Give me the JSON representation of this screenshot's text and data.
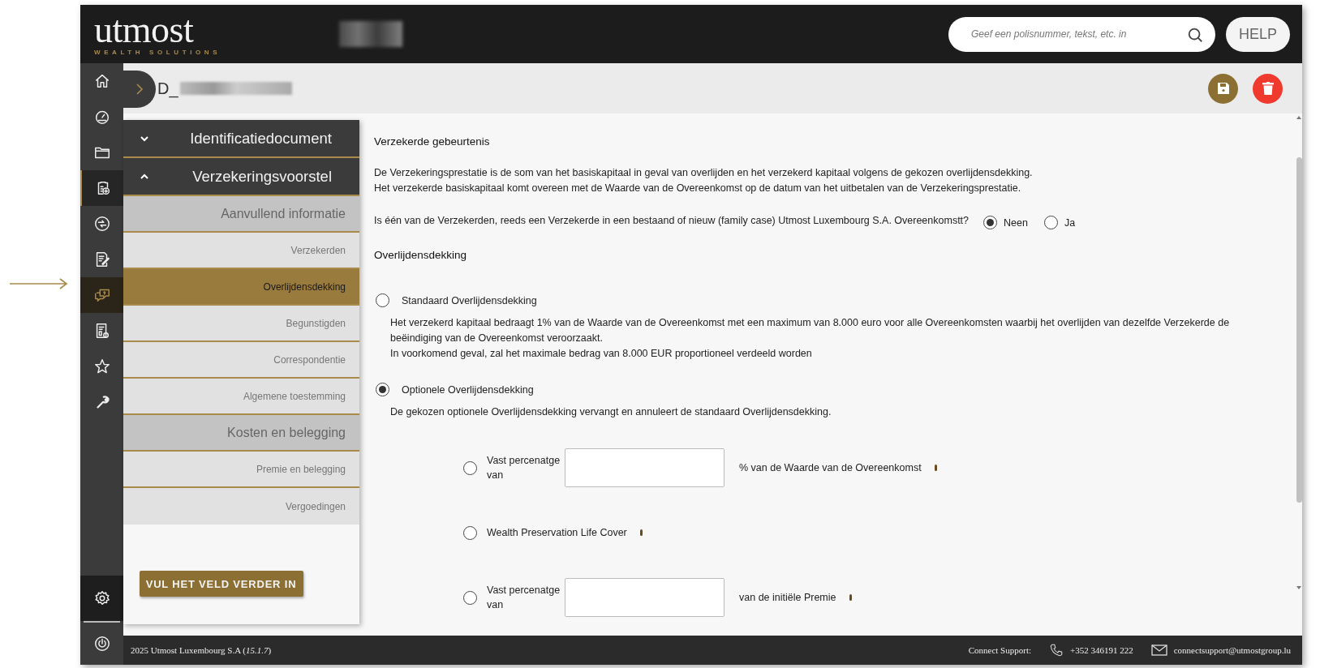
{
  "header": {
    "logo": "utmost",
    "logo_subtitle": "WEALTH SOLUTIONS",
    "search": {
      "placeholder": "Geef een polisnummer, tekst, etc. in"
    },
    "help": "HELP"
  },
  "rail": {
    "items": [
      {
        "kind": "home",
        "selected": false,
        "highlighted": false
      },
      {
        "kind": "gauge",
        "selected": false,
        "highlighted": false
      },
      {
        "kind": "folder",
        "selected": false,
        "highlighted": false
      },
      {
        "kind": "clipboard",
        "selected": false,
        "highlighted": true
      },
      {
        "kind": "globe",
        "selected": false,
        "highlighted": false
      },
      {
        "kind": "edit",
        "selected": false,
        "highlighted": false
      },
      {
        "kind": "chat",
        "selected": true,
        "highlighted": false
      },
      {
        "kind": "report",
        "selected": false,
        "highlighted": false
      },
      {
        "kind": "star",
        "selected": false,
        "highlighted": false
      },
      {
        "kind": "wrench",
        "selected": false,
        "highlighted": false
      }
    ],
    "bottom_items": [
      {
        "kind": "gear"
      },
      {
        "kind": "power"
      }
    ]
  },
  "record_title": "D_",
  "nav": {
    "sections": [
      {
        "label": "Identificatiedocument",
        "expanded": false
      },
      {
        "label": "Verzekeringsvoorstel",
        "expanded": true,
        "children": [
          {
            "kind": "group",
            "label": "Aanvullend informatie"
          },
          {
            "kind": "page",
            "label": "Verzekerden",
            "selected": false
          },
          {
            "kind": "page",
            "label": "Overlijdensdekking",
            "selected": true
          },
          {
            "kind": "page",
            "label": "Begunstigden",
            "selected": false
          },
          {
            "kind": "page",
            "label": "Correspondentie",
            "selected": false
          },
          {
            "kind": "page",
            "label": "Algemene toestemming",
            "selected": false
          },
          {
            "kind": "group",
            "label": "Kosten en belegging"
          },
          {
            "kind": "page",
            "label": "Premie en belegging",
            "selected": false
          },
          {
            "kind": "page",
            "label": "Vergoedingen",
            "selected": false
          }
        ]
      }
    ],
    "button": "VUL HET VELD VERDER IN"
  },
  "content": {
    "heading": "Verzekerde gebeurtenis",
    "paragraph": [
      "De Verzekeringsprestatie is de som van het basiskapitaal in geval van overlijden en het verzekerd kapitaal volgens de gekozen overlijdensdekking.",
      "Het verzekerde basiskapitaal komt overeen met de Waarde van de Overeenkomst op de datum van het uitbetalen van de Verzekeringsprestatie."
    ],
    "question": "Is één van de Verzekerden, reeds een Verzekerde in een bestaand of nieuw (family case) Utmost Luxembourg S.A. Overeenkomstt?",
    "answers": [
      {
        "label": "Neen",
        "selected": true
      },
      {
        "label": "Ja",
        "selected": false
      }
    ],
    "coverage_heading": "Overlijdensdekking",
    "coverage_options": [
      {
        "label": "Standaard Overlijdensdekking",
        "selected": false,
        "description": [
          "Het verzekerd kapitaal bedraagt 1% van de Waarde van de Overeenkomst met een maximum van 8.000 euro voor alle Overeenkomsten waarbij het overlijden van dezelfde Verzekerde de beëindiging van de Overeenkomst veroorzaakt.",
          "In voorkomend geval, zal het maximale bedrag van 8.000 EUR proportioneel verdeeld worden"
        ]
      },
      {
        "label": "Optionele Overlijdensdekking",
        "selected": true,
        "description": [
          "De gekozen optionele Overlijdensdekking vervangt en annuleert de standaard Overlijdensdekking."
        ],
        "sub_options": [
          {
            "kind": "field",
            "label": "Vast percenatge van",
            "suffix": "% van de Waarde van de Overeenkomst",
            "selected": false
          },
          {
            "kind": "plain",
            "label": "Wealth Preservation Life Cover",
            "selected": false
          },
          {
            "kind": "field",
            "label": "Vast percenatge van",
            "suffix": "van de initiële Premie",
            "selected": false
          }
        ]
      }
    ]
  },
  "footer": {
    "copyright": "2025 Utmost Luxembourg S.A (*15.1.7*)",
    "support_label": "Connect Support:",
    "phone": "+352 346191 222",
    "email": "connectsupport@utmostgroup.lu"
  }
}
